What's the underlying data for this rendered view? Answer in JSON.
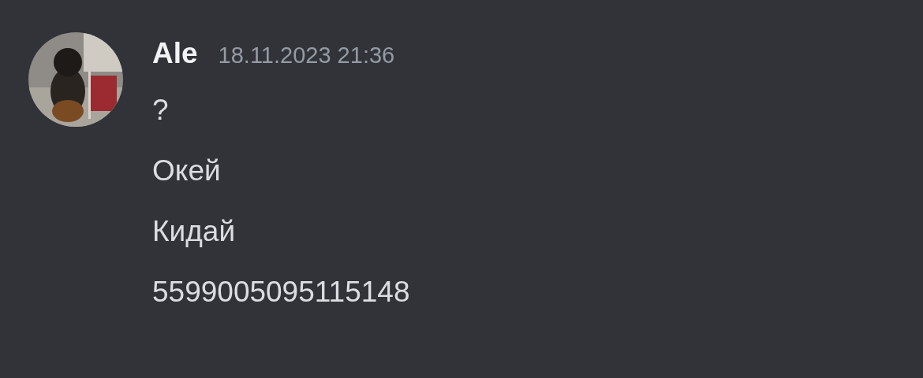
{
  "message": {
    "author": "Ale",
    "timestamp": "18.11.2023 21:36",
    "lines": [
      "?",
      "Окей",
      "Кидай",
      "5599005095115148"
    ]
  }
}
